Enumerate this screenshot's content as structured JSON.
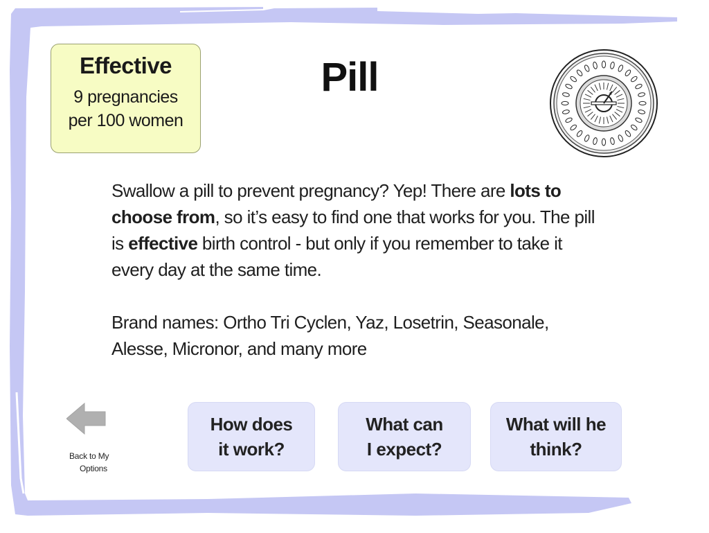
{
  "effectiveness": {
    "title": "Effective",
    "line1": "9 pregnancies",
    "line2": "per 100 women"
  },
  "page_title": "Pill",
  "icon": "pill-pack-icon",
  "description": {
    "part1": "Swallow a pill to prevent pregnancy? Yep! There are ",
    "bold1": "lots to choose from",
    "part2": ", so it’s easy to find one that works for you. The pill is ",
    "bold2": "effective",
    "part3": " birth control - but only if you remember to take it every day at the same time."
  },
  "brand_names": "Brand names: Ortho Tri Cyclen, Yaz, Losetrin, Seasonale, Alesse, Micronor, and many more",
  "back_button": {
    "line1": "Back to My",
    "line2": "Options",
    "icon": "back-arrow-icon"
  },
  "nav_buttons": [
    {
      "label": "How does\nit work?"
    },
    {
      "label": "What can\nI expect?"
    },
    {
      "label": "What will he\nthink?"
    }
  ],
  "colors": {
    "frame": "#c5c7f4",
    "effective_box": "#f7fcc4",
    "nav_button": "#e4e6fb",
    "back_arrow": "#b0b0b0"
  }
}
